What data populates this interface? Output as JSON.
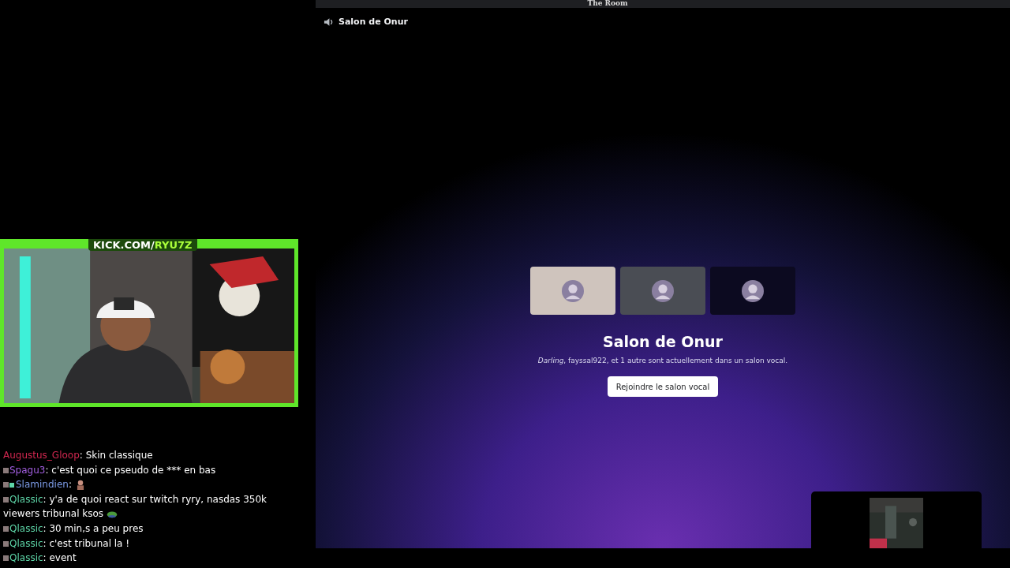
{
  "overlay": {
    "frame_label": "KICK.COM/",
    "frame_channel": "RYU7Z"
  },
  "chat": [
    {
      "user": "Augustus_Gloop",
      "color": "#d0274f",
      "subscriber": false,
      "moderator": false,
      "text": ": Skin classique"
    },
    {
      "user": "Spagu3",
      "color": "#a25ee0",
      "subscriber": true,
      "moderator": false,
      "text": ": c'est quoi ce pseudo de *** en bas"
    },
    {
      "user": "Slamindien",
      "color": "#7c9be6",
      "subscriber": true,
      "moderator": true,
      "text": ":",
      "emote": {
        "kind": "figure"
      }
    },
    {
      "user": "Qlassic",
      "color": "#5ed6a8",
      "subscriber": true,
      "moderator": false,
      "text": ": y'a de quoi react sur twitch ryry, nasdas 350k viewers tribunal ksos",
      "emote": {
        "kind": "frog"
      }
    },
    {
      "user": "Qlassic",
      "color": "#5ed6a8",
      "subscriber": true,
      "moderator": false,
      "text": ": 30 min,s a peu pres"
    },
    {
      "user": "Qlassic",
      "color": "#5ed6a8",
      "subscriber": true,
      "moderator": false,
      "text": ": c'est tribunal la !"
    },
    {
      "user": "Qlassic",
      "color": "#5ed6a8",
      "subscriber": true,
      "moderator": false,
      "text": ": event"
    }
  ],
  "discord": {
    "window_title": "The Room",
    "channel_header": "Salon de Onur",
    "tiles": [
      {
        "color": "#cfc4bd"
      },
      {
        "color": "#4a4d54"
      },
      {
        "color": "#0c0a20"
      }
    ],
    "title": "Salon de Onur",
    "subtitle": "*Darling*, fayssal922, et 1 autre sont actuellement dans un salon vocal.",
    "join_button": "Rejoindre le salon vocal"
  }
}
